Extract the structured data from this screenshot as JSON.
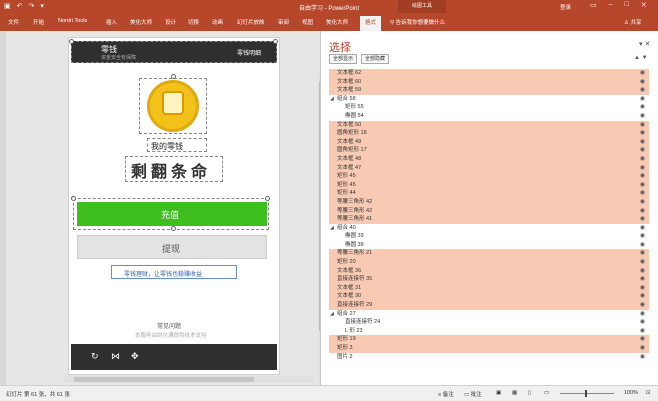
{
  "titlebar": {
    "doc_title": "自由学习 - PowerPoint",
    "drawing_tools": "绘图工具",
    "signin": "登录",
    "qat_icons": [
      "save-icon",
      "undo-icon",
      "redo-icon",
      "customize-icon"
    ]
  },
  "ribbon": {
    "tabs": [
      "文件",
      "开始",
      "Nordri Tools",
      "插入",
      "美化大师",
      "设计",
      "切换",
      "动画",
      "幻灯片放映",
      "审阅",
      "视图",
      "美化大师",
      "格式"
    ],
    "active_tab": "格式",
    "tell_me": "告诉我你想要做什么",
    "share": "共享"
  },
  "slide": {
    "header_left": "零钱",
    "header_sub": "资金安全有保障",
    "header_right": "零钱明细",
    "coin_label": "我的零钱",
    "balance_text": "剩翻条命",
    "green_button": "充值",
    "gray_button": "提现",
    "promo_text": "零钱理财，让零钱也稳赚收益",
    "faq_link": "常见问题",
    "footer_note": "本服务由财付通提供技术支持",
    "colors": {
      "dark_bar": "#2f2f2f",
      "green": "#3fbf1f",
      "gray": "#e3e3e3",
      "coin": "#f2c11a"
    }
  },
  "panel": {
    "title": "选择",
    "show_all": "全部显示",
    "hide_all": "全部隐藏",
    "items": [
      {
        "label": "文本框 62",
        "level": 0,
        "highlight": true
      },
      {
        "label": "文本框 60",
        "level": 0,
        "highlight": true
      },
      {
        "label": "文本框 59",
        "level": 0,
        "highlight": true
      },
      {
        "label": "组合 58",
        "level": 0,
        "highlight": false,
        "group": true
      },
      {
        "label": "矩形 55",
        "level": 1,
        "highlight": false
      },
      {
        "label": "椭圆 54",
        "level": 1,
        "highlight": false
      },
      {
        "label": "文本框 50",
        "level": 0,
        "highlight": true
      },
      {
        "label": "圆角矩形 18",
        "level": 0,
        "highlight": true
      },
      {
        "label": "文本框 49",
        "level": 0,
        "highlight": true
      },
      {
        "label": "圆角矩形 17",
        "level": 0,
        "highlight": true
      },
      {
        "label": "文本框 48",
        "level": 0,
        "highlight": true
      },
      {
        "label": "文本框 47",
        "level": 0,
        "highlight": true
      },
      {
        "label": "矩形 45",
        "level": 0,
        "highlight": true
      },
      {
        "label": "矩形 45",
        "level": 0,
        "highlight": true
      },
      {
        "label": "矩形 44",
        "level": 0,
        "highlight": true
      },
      {
        "label": "等腰三角形 42",
        "level": 0,
        "highlight": true
      },
      {
        "label": "等腰三角形 42",
        "level": 0,
        "highlight": true
      },
      {
        "label": "等腰三角形 41",
        "level": 0,
        "highlight": true
      },
      {
        "label": "组合 40",
        "level": 0,
        "highlight": false,
        "group": true
      },
      {
        "label": "椭圆 39",
        "level": 1,
        "highlight": false
      },
      {
        "label": "椭圆 38",
        "level": 1,
        "highlight": false
      },
      {
        "label": "等腰三角形 21",
        "level": 0,
        "highlight": true
      },
      {
        "label": "矩形 20",
        "level": 0,
        "highlight": true
      },
      {
        "label": "文本框 36",
        "level": 0,
        "highlight": true
      },
      {
        "label": "直接连接符 35",
        "level": 0,
        "highlight": true
      },
      {
        "label": "文本框 31",
        "level": 0,
        "highlight": true
      },
      {
        "label": "文本框 30",
        "level": 0,
        "highlight": true
      },
      {
        "label": "直接连接符 29",
        "level": 0,
        "highlight": true
      },
      {
        "label": "组合 27",
        "level": 0,
        "highlight": false,
        "group": true
      },
      {
        "label": "直接连接符 24",
        "level": 1,
        "highlight": false
      },
      {
        "label": "L 形 23",
        "level": 1,
        "highlight": false
      },
      {
        "label": "矩形 19",
        "level": 0,
        "highlight": true
      },
      {
        "label": "矩形 3",
        "level": 0,
        "highlight": true
      },
      {
        "label": "图片 2",
        "level": 0,
        "highlight": false
      }
    ]
  },
  "status": {
    "slide_count": "幻灯片 第 61 张，共 61 张",
    "notes": "备注",
    "comments": "批注",
    "zoom": "100%"
  }
}
